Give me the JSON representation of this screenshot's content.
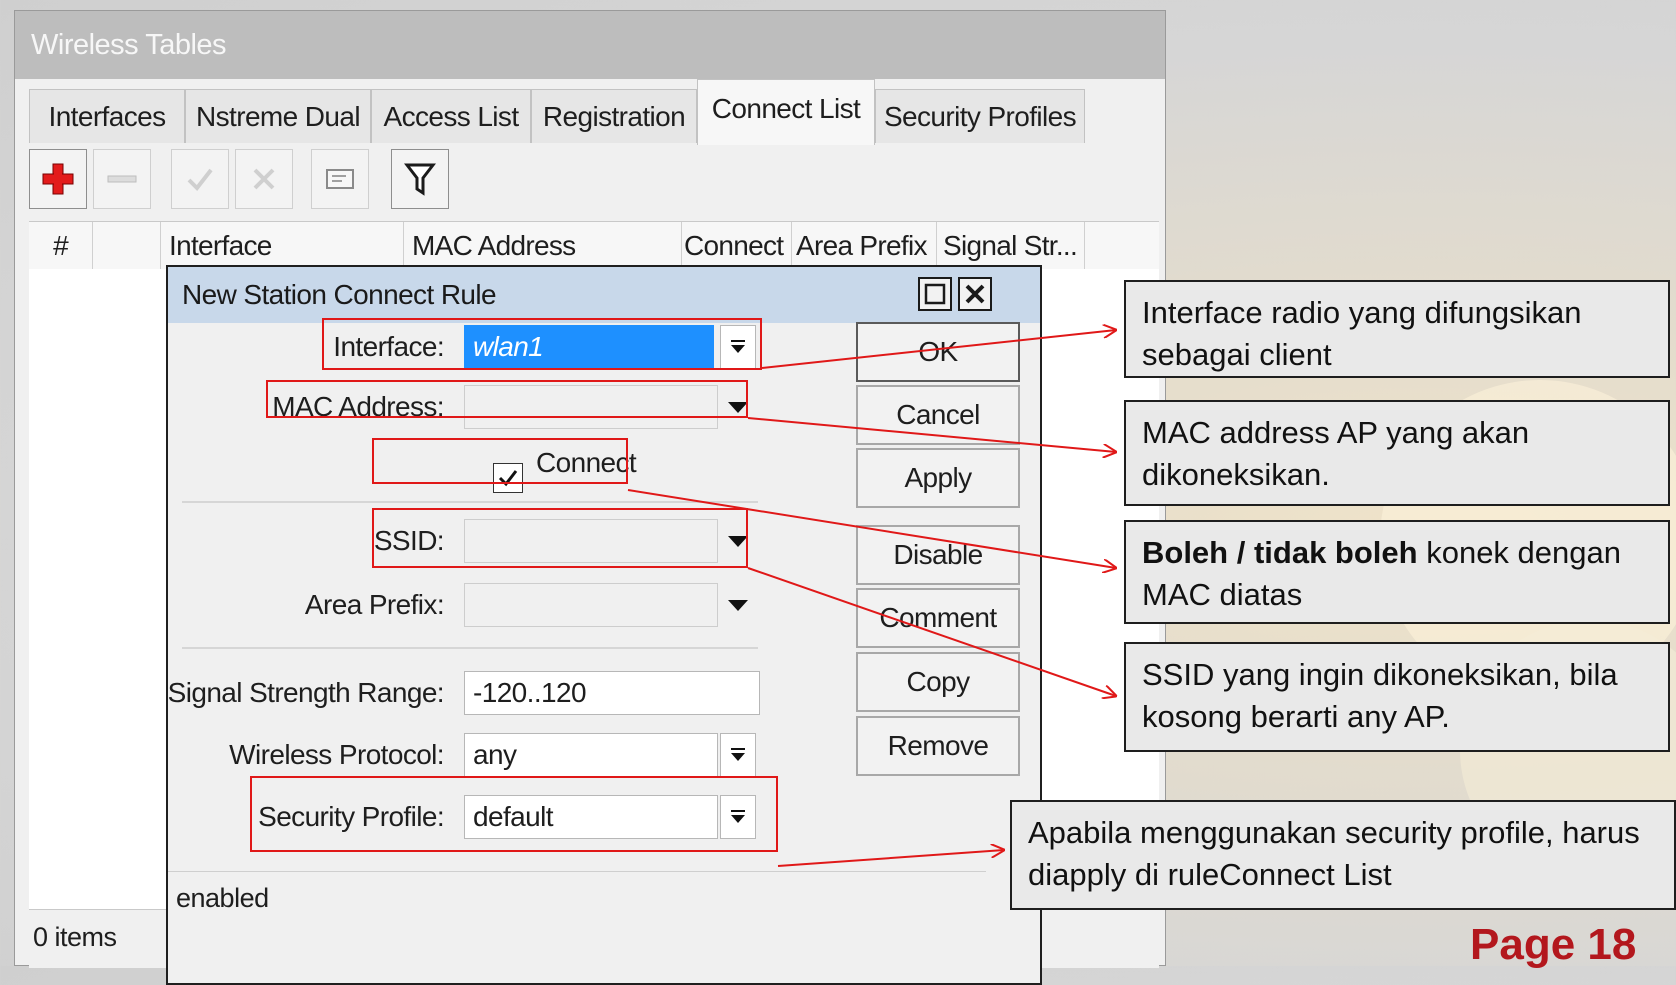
{
  "window": {
    "title": "Wireless Tables",
    "tabs": [
      {
        "label": "Interfaces"
      },
      {
        "label": "Nstreme Dual"
      },
      {
        "label": "Access List"
      },
      {
        "label": "Registration"
      },
      {
        "label": "Connect List"
      },
      {
        "label": "Security Profiles"
      }
    ],
    "active_tab": "Connect List",
    "toolbar": {
      "add": "plus-icon",
      "remove": "minus-icon",
      "enable": "check-icon",
      "disable": "cross-icon",
      "comment": "comment-icon",
      "filter": "filter-icon"
    },
    "columns": [
      "#",
      "",
      "Interface",
      "MAC Address",
      "Connect",
      "Area Prefix",
      "Signal Str..."
    ],
    "items_count": "0 items"
  },
  "dialog": {
    "title": "New Station Connect Rule",
    "fields": {
      "interface": {
        "label": "Interface:",
        "value": "wlan1"
      },
      "mac_address": {
        "label": "MAC Address:",
        "value": ""
      },
      "connect": {
        "label": "Connect",
        "checked": true
      },
      "ssid": {
        "label": "SSID:",
        "value": ""
      },
      "area_prefix": {
        "label": "Area Prefix:",
        "value": ""
      },
      "signal_strength": {
        "label": "Signal Strength Range:",
        "value": "-120..120"
      },
      "wireless_protocol": {
        "label": "Wireless Protocol:",
        "value": "any"
      },
      "security_profile": {
        "label": "Security Profile:",
        "value": "default"
      }
    },
    "buttons": {
      "ok": "OK",
      "cancel": "Cancel",
      "apply": "Apply",
      "disable": "Disable",
      "comment": "Comment",
      "copy": "Copy",
      "remove": "Remove"
    },
    "status": "enabled"
  },
  "callouts": {
    "interface": "Interface radio yang difungsikan sebagai client",
    "mac": "MAC address AP yang akan dikoneksikan.",
    "connect_bold": "Boleh / tidak boleh",
    "connect_rest": " konek dengan MAC diatas",
    "ssid": "SSID yang ingin dikoneksikan, bila kosong berarti any AP.",
    "security": "Apabila menggunakan security profile, harus diapply di ruleConnect List"
  },
  "page_label": "Page 18",
  "colors": {
    "annotation": "#e01818",
    "selection": "#1e90ff",
    "page_label": "#b3171d"
  }
}
